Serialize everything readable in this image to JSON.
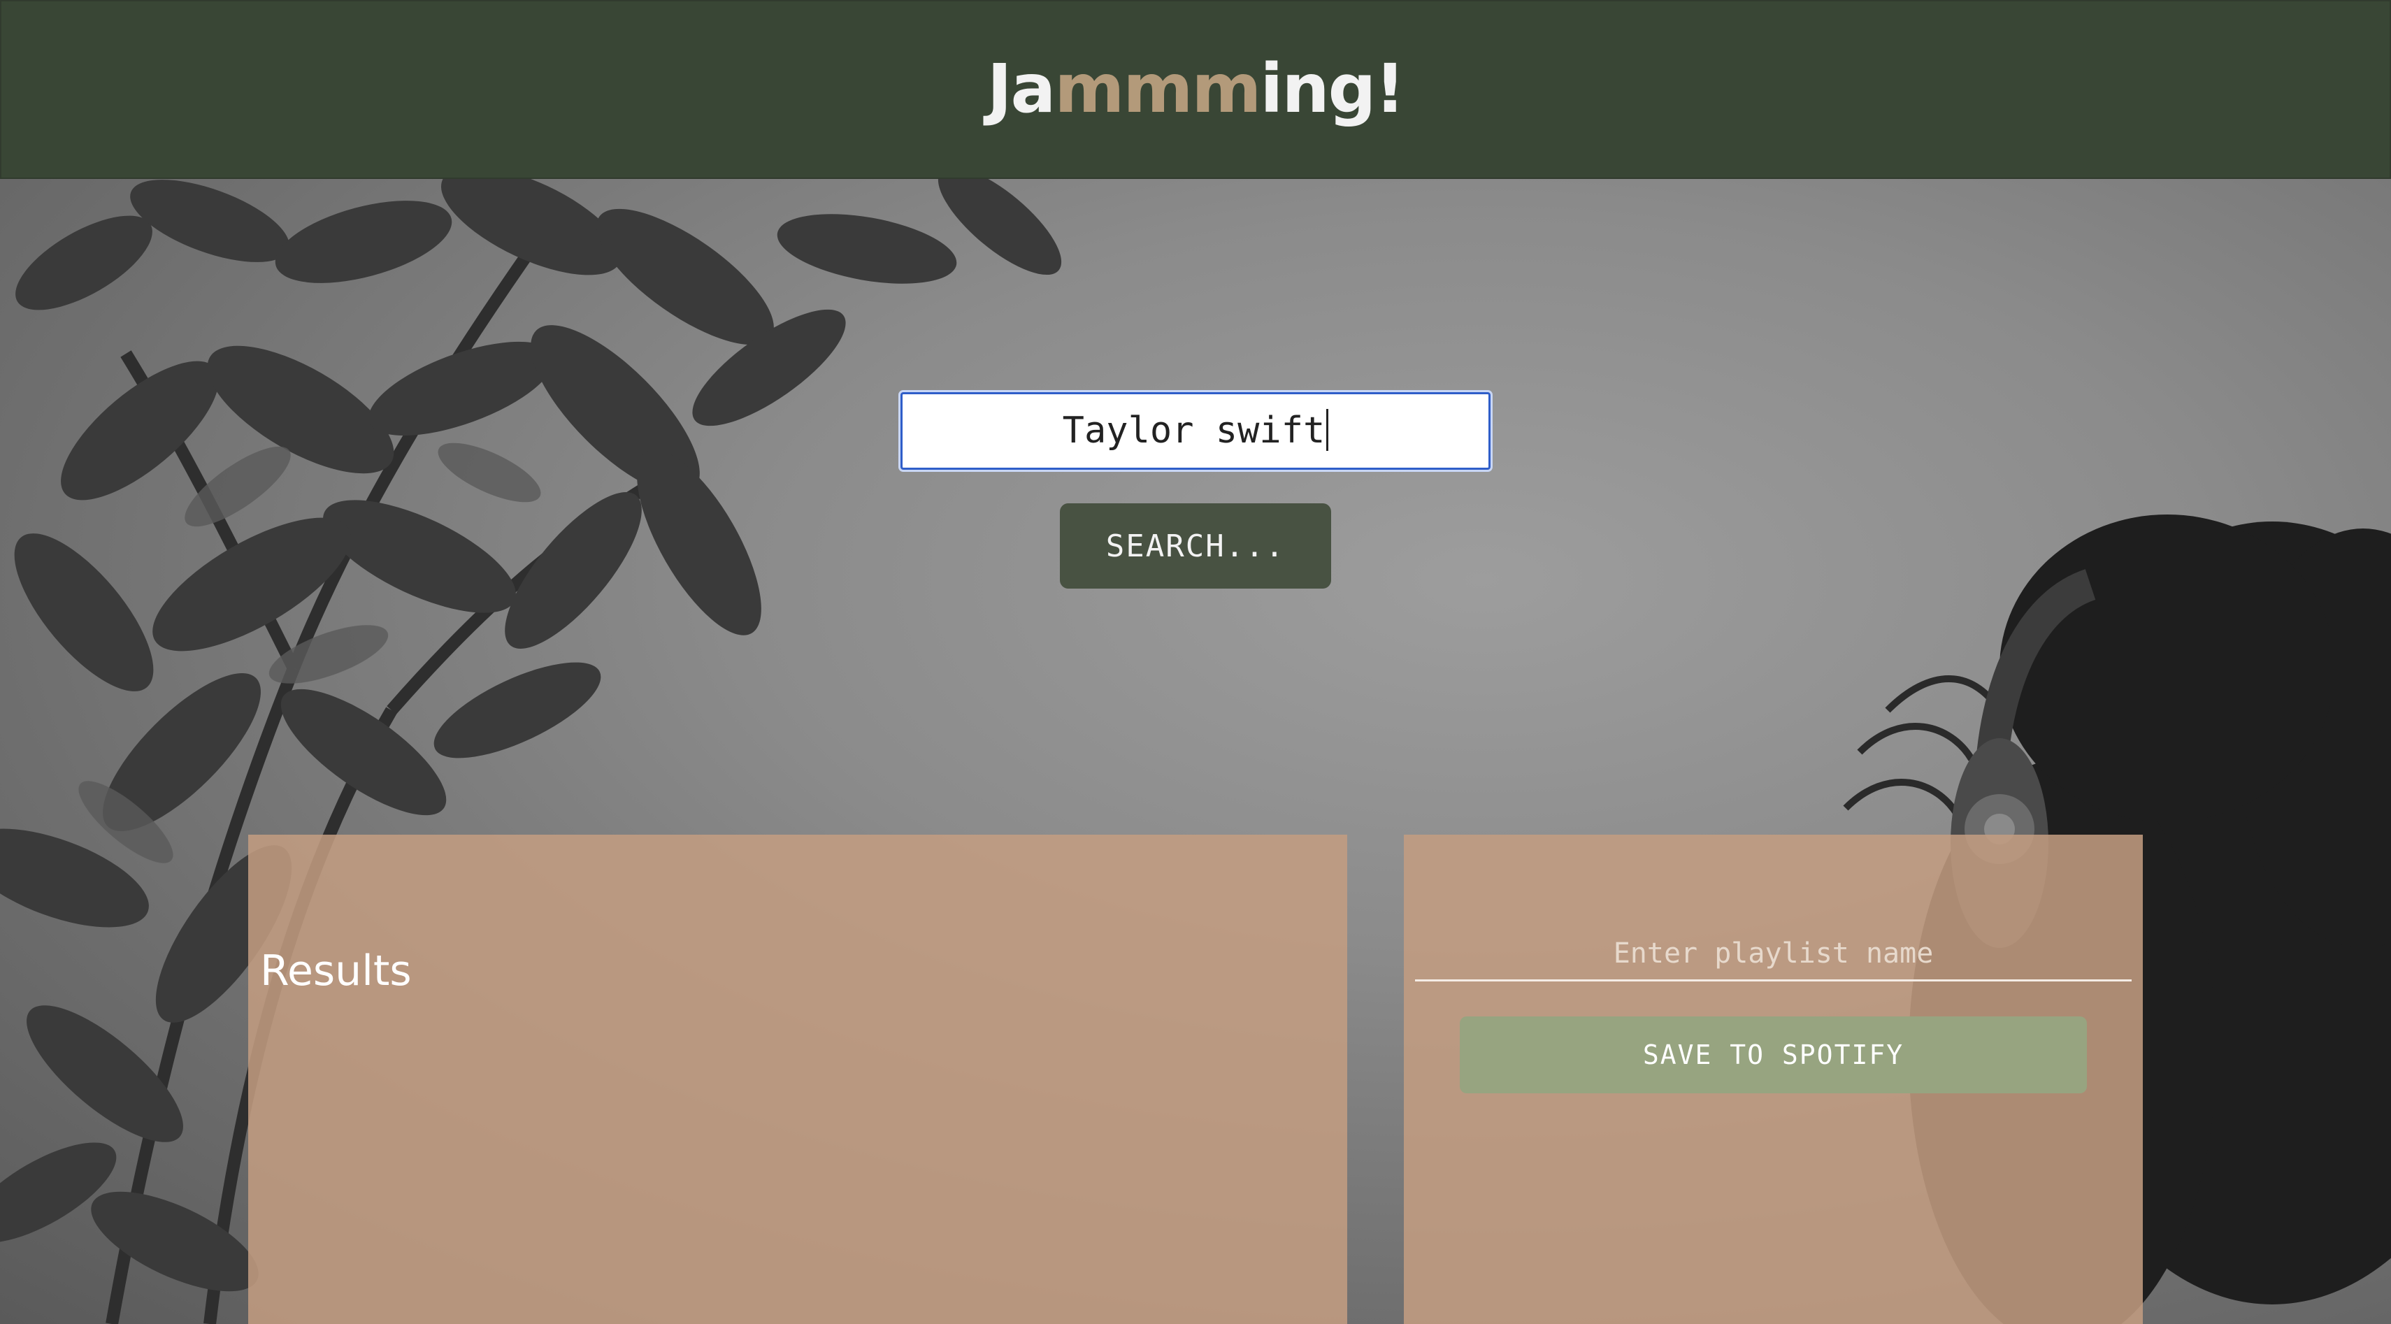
{
  "header": {
    "logo_prefix": "Ja",
    "logo_accent": "mmm",
    "logo_suffix": "ing!",
    "background_color": "#394635",
    "accent_color": "#b39a7a"
  },
  "search": {
    "value": "Taylor swift",
    "button_label": "SEARCH..."
  },
  "results": {
    "title": "Results"
  },
  "playlist": {
    "name_placeholder": "Enter playlist name",
    "save_label": "SAVE TO SPOTIFY",
    "save_color": "#97a480"
  },
  "background": {
    "description_icon": "plant-and-headphones-photo"
  }
}
